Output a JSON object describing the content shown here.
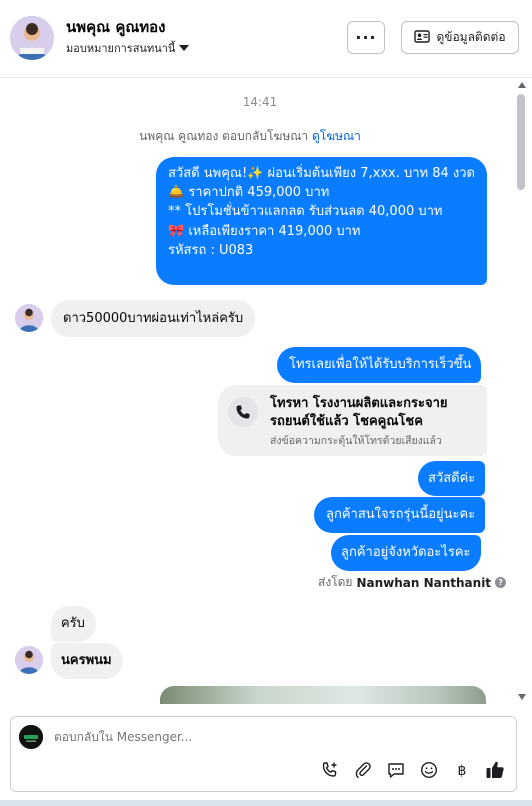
{
  "header": {
    "name": "นพคุณ คูณทอง",
    "assign_label": "มอบหมายการสนทนานี้",
    "more_label": "···",
    "contact_label": "ดูข้อมูลติดต่อ"
  },
  "thread": {
    "time": "14:41",
    "reply_note_prefix": "นพคุณ คูณทอง ตอบกลับโฆษณา",
    "reply_note_link": "ดูโฆษณา",
    "ad_message": "สวัสดี นพคุณ!✨  ผ่อนเริ่มต้นเพียง 7,xxx. บาท 84 งวด\n🛎️ ราคาปกติ 459,000 บาท\n** โปรโมชั่นข้าวแลกลด รับส่วนลด 40,000 บาท\n🎀  เหลือเพียงราคา 419,000 บาท\n รหัสรถ : U083",
    "in_1": "ดาว50000บาทผ่อนเท่าไหล่ครับ",
    "out_call_prompt": "โทรเลยเพื่อให้ได้รับบริการเร็วขึ้น",
    "call_card": {
      "title": "โทรหา โรงงานผลิตและกระจายรถยนต์ใช้แล้ว โชคคูณโชค",
      "subtitle": "ส่งข้อความกระตุ้นให้โทรด้วยเสียงแล้ว"
    },
    "out_2": "สวัสดีค่ะ",
    "out_3": "ลูกค้าสนใจรถรุ่นนี้อยู่นะคะ",
    "out_4": "ลูกค้าอยู่จังหวัดอะไรคะ",
    "sent_by_prefix": "ส่งโดย",
    "sent_by_name": "Nanwhan Nanthanit",
    "in_2": "ครับ",
    "in_3": "นครพนม"
  },
  "composer": {
    "placeholder": "ตอบกลับใน Messenger..."
  },
  "icons": [
    "more-icon",
    "contact-card-icon",
    "caret-down-icon",
    "phone-icon",
    "info-icon",
    "call-add-icon",
    "attach-icon",
    "saved-reply-icon",
    "emoji-icon",
    "baht-icon",
    "thumbs-up-icon"
  ],
  "colors": {
    "outgoing": "#0a7cff",
    "incoming": "#f0f0f0",
    "link": "#0064d1"
  }
}
